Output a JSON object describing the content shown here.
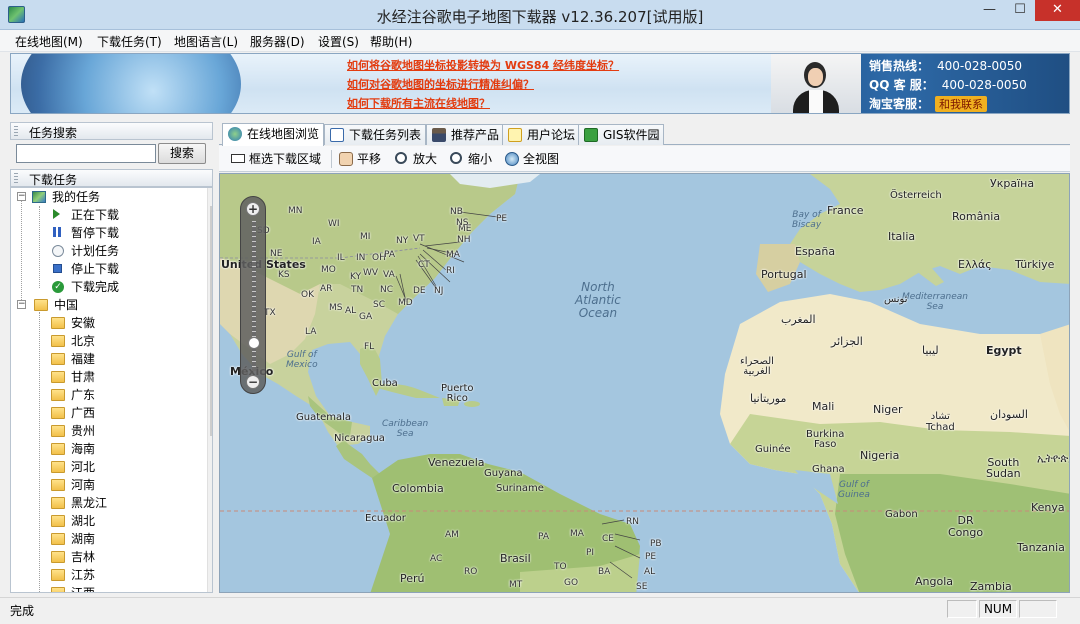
{
  "window": {
    "title": "水经注谷歌电子地图下载器 v12.36.207[试用版]",
    "min": "—",
    "max": "☐",
    "close": "✕"
  },
  "menu": [
    "在线地图(M)",
    "下载任务(T)",
    "地图语言(L)",
    "服务器(D)",
    "设置(S)",
    "帮助(H)"
  ],
  "banner": {
    "faq": [
      "如何将谷歌地图坐标投影转换为 WGS84 经纬度坐标？",
      "如何对谷歌地图的坐标进行精准纠偏？",
      "如何下载所有主流在线地图？"
    ],
    "contacts": [
      {
        "label": "销售热线：",
        "value": "400-028-0050"
      },
      {
        "label": "QQ 客 服：",
        "value": "400-028-0050"
      },
      {
        "label": "淘宝客服：",
        "value": "和我联系"
      }
    ]
  },
  "search_panel": {
    "title": "任务搜索",
    "input_value": "",
    "button": "搜索"
  },
  "task_panel": {
    "title": "下载任务",
    "my_tasks": "我的任务",
    "task_items": [
      "正在下载",
      "暂停下载",
      "计划任务",
      "停止下载",
      "下载完成"
    ],
    "china": "中国",
    "provinces": [
      "安徽",
      "北京",
      "福建",
      "甘肃",
      "广东",
      "广西",
      "贵州",
      "海南",
      "河北",
      "河南",
      "黑龙江",
      "湖北",
      "湖南",
      "吉林",
      "江苏",
      "江西"
    ]
  },
  "tabs": [
    "在线地图浏览",
    "下载任务列表",
    "推荐产品",
    "用户论坛",
    "GIS软件园"
  ],
  "toolbar": [
    "框选下载区域",
    "平移",
    "放大",
    "缩小",
    "全视图"
  ],
  "map": {
    "ocean_label": [
      "North",
      "Atlantic",
      "Ocean"
    ],
    "seas": {
      "gulf_mexico": [
        "Gulf of",
        "Mexico"
      ],
      "caribbean": [
        "Caribbean",
        "Sea"
      ],
      "biscay": [
        "Bay of",
        "Biscay"
      ],
      "mediterranean": [
        "Mediterranean",
        "Sea"
      ],
      "guinea": [
        "Gulf of",
        "Guinea"
      ]
    },
    "places": {
      "united_states": "United States",
      "mexico": "México",
      "cuba": "Cuba",
      "puerto_rico": [
        "Puerto",
        "Rico"
      ],
      "guatemala": "Guatemala",
      "nicaragua": "Nicaragua",
      "venezuela": "Venezuela",
      "guyana": "Guyana",
      "suriname": "Suriname",
      "colombia": "Colombia",
      "ecuador": "Ecuador",
      "brasil": "Brasil",
      "peru": "Perú",
      "france": "France",
      "espana": "España",
      "portugal": "Portugal",
      "italia": "Italia",
      "osterreich": "Österreich",
      "romania": "România",
      "ukraina": "Україна",
      "turkiye": "Türkiye",
      "ellas": "Ελλάς",
      "tunis": "تونس",
      "maghrib": "المغرب",
      "jazair": "الجزائر",
      "libya": "ليبيا",
      "egypt": "Egypt",
      "sahara": [
        "الصحراء",
        "الغربية"
      ],
      "mauritania": "موريتانيا",
      "mali": "Mali",
      "niger": "Niger",
      "tchad": [
        "تشاد",
        "Tchad"
      ],
      "sudan": "السودان",
      "burkina": [
        "Burkina",
        "Faso"
      ],
      "guinee": "Guinée",
      "ghana": "Ghana",
      "nigeria": "Nigeria",
      "south_sudan": [
        "South",
        "Sudan"
      ],
      "ethiopia": "ኢትዮጵያ",
      "gabon": "Gabon",
      "dr_congo": [
        "DR",
        "Congo"
      ],
      "kenya": "Kenya",
      "tanzania": "Tanzania",
      "angola": "Angola",
      "zambia": "Zambia"
    },
    "states": [
      "MN",
      "SD",
      "IA",
      "NE",
      "KS",
      "OK",
      "TX",
      "LA",
      "MS",
      "AL",
      "AR",
      "MO",
      "TN",
      "KY",
      "IL",
      "IN",
      "OH",
      "WV",
      "VA",
      "NC",
      "SC",
      "GA",
      "FL",
      "MI",
      "WI",
      "PA",
      "NY",
      "VT",
      "NH",
      "ME",
      "MA",
      "CT",
      "RI",
      "NJ",
      "DE",
      "MD",
      "NB",
      "NS",
      "PE",
      "AM",
      "PA",
      "MA",
      "CE",
      "RN",
      "PB",
      "PE",
      "PI",
      "TO",
      "BA",
      "AL",
      "SE",
      "MT",
      "RO",
      "AC",
      "GO"
    ],
    "zoom_plus": "+",
    "zoom_minus": "−"
  },
  "status": {
    "text": "完成",
    "num": "NUM"
  },
  "colors": {
    "ocean": "#a4c6df",
    "land": "#e9e3c8",
    "desert": "#f2ebcf",
    "forest": "#b7cc8f",
    "faq": "#e33c10",
    "close": "#c7312a"
  }
}
